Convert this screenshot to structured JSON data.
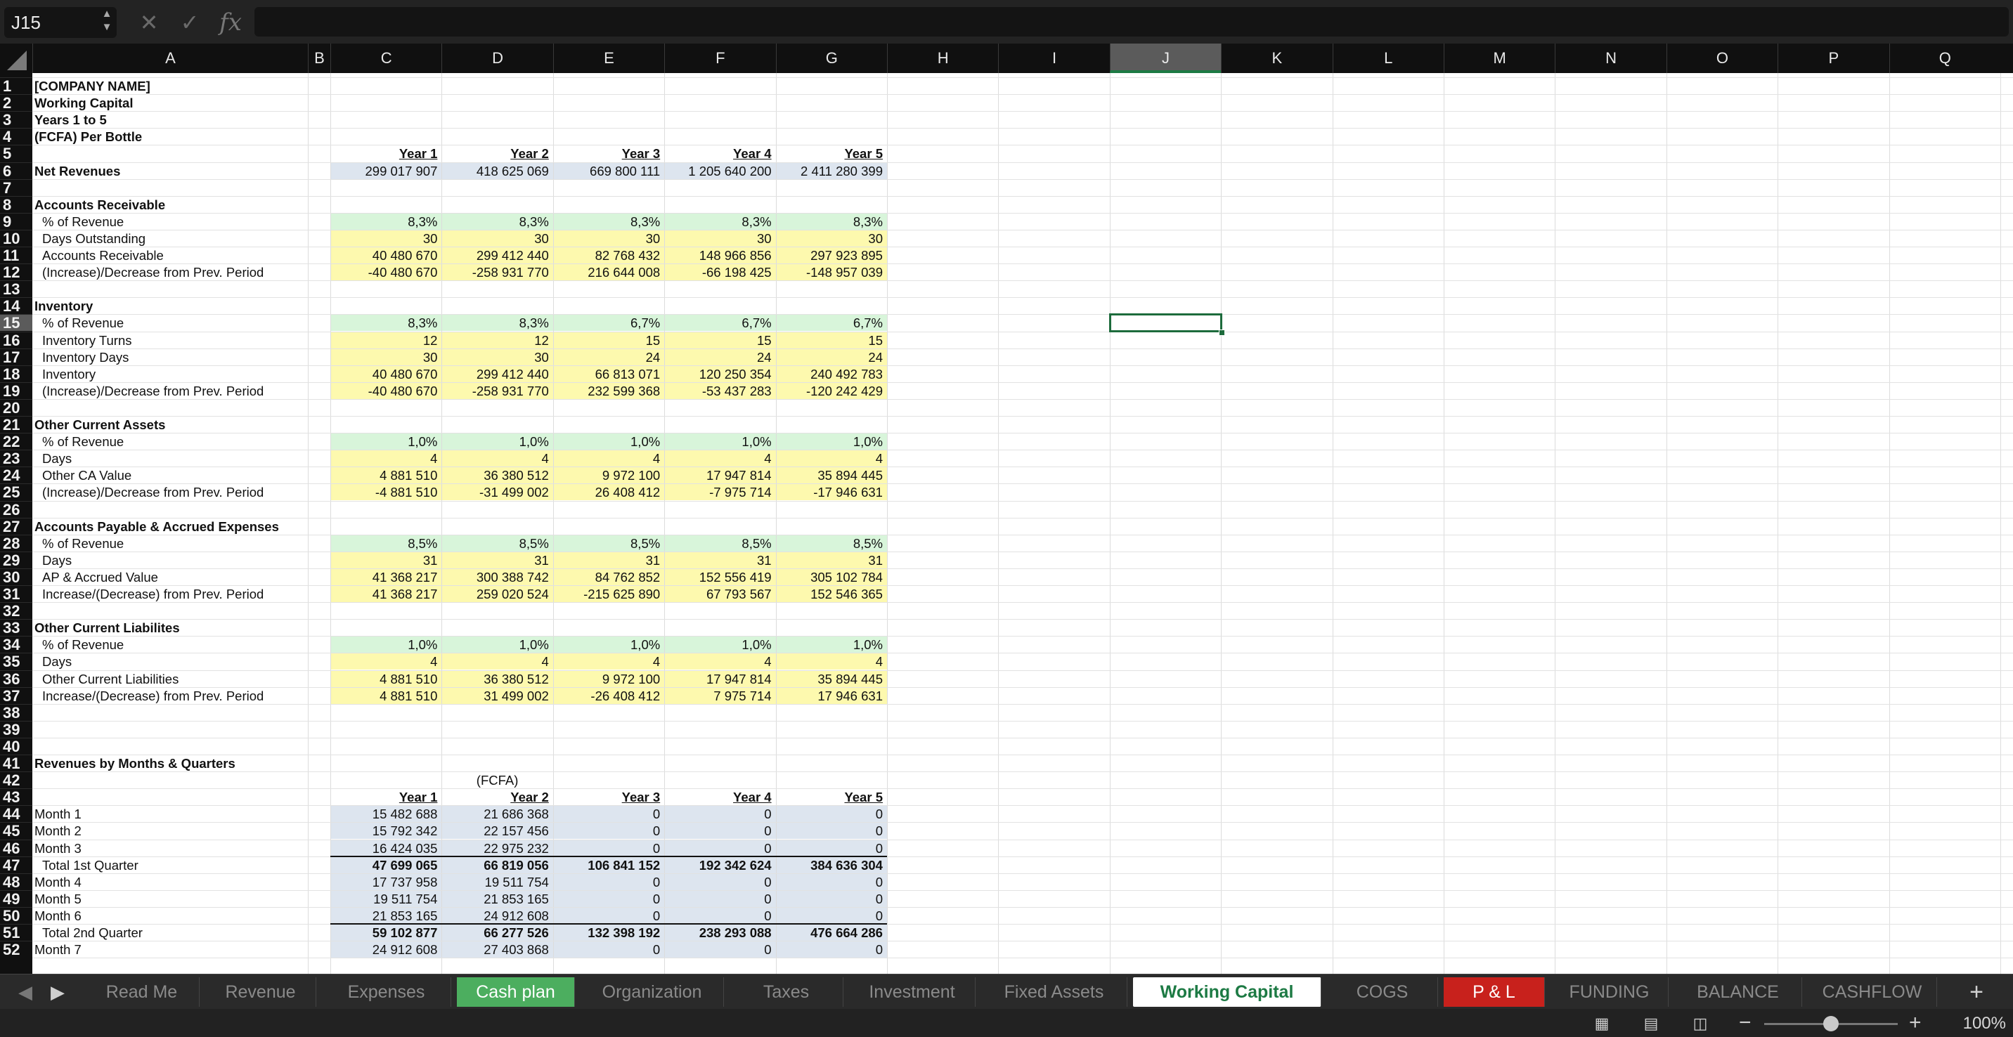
{
  "formula_bar": {
    "name_box": "J15",
    "cancel_glyph": "✕",
    "enter_glyph": "✓",
    "fx_glyph": "fx",
    "formula": ""
  },
  "columns": [
    "A",
    "B",
    "C",
    "D",
    "E",
    "F",
    "G",
    "H",
    "I",
    "J",
    "K",
    "L",
    "M",
    "N",
    "O",
    "P",
    "Q"
  ],
  "selected_column": "J",
  "selected_row": 15,
  "selected_cell": "J15",
  "rows": [
    1,
    2,
    3,
    4,
    5,
    6,
    7,
    8,
    9,
    10,
    11,
    12,
    13,
    14,
    15,
    16,
    17,
    18,
    19,
    20,
    21,
    22,
    23,
    24,
    25,
    26,
    27,
    28,
    29,
    30,
    31,
    32,
    33,
    34,
    35,
    36,
    37,
    38,
    39,
    40,
    41,
    42,
    43,
    44,
    45,
    46,
    47,
    48,
    49,
    50,
    51,
    52
  ],
  "colors": {
    "green_fill": "#d8f5da",
    "yellow_fill": "#fdf9ae",
    "blue_fill": "#dde5ef",
    "selection": "#1d6b3c",
    "tab_green": "#4cae5f",
    "tab_red": "#c8211c"
  },
  "sheet": {
    "a1": "[COMPANY NAME]",
    "a2": "Working Capital",
    "a3": "Years 1 to 5",
    "a4": "(FCFA) Per Bottle",
    "years": [
      "Year 1",
      "Year 2",
      "Year 3",
      "Year 4",
      "Year 5"
    ],
    "net_revenues": {
      "label": "Net Revenues",
      "values": [
        "299 017 907",
        "418 625 069",
        "669 800 111",
        "1 205 640 200",
        "2 411 280 399"
      ]
    },
    "sections": [
      {
        "title": "Accounts Receivable",
        "row": 8,
        "rows": [
          {
            "label": "% of Revenue",
            "values": [
              "8,3%",
              "8,3%",
              "8,3%",
              "8,3%",
              "8,3%"
            ]
          },
          {
            "label": "Days Outstanding",
            "values": [
              "30",
              "30",
              "30",
              "30",
              "30"
            ]
          },
          {
            "label": "Accounts Receivable",
            "values": [
              "40 480 670",
              "299 412 440",
              "82 768 432",
              "148 966 856",
              "297 923 895"
            ]
          },
          {
            "label": "(Increase)/Decrease from Prev. Period",
            "values": [
              "-40 480 670",
              "-258 931 770",
              "216 644 008",
              "-66 198 425",
              "-148 957 039"
            ]
          }
        ]
      },
      {
        "title": "Inventory",
        "row": 14,
        "rows": [
          {
            "label": "% of Revenue",
            "values": [
              "8,3%",
              "8,3%",
              "6,7%",
              "6,7%",
              "6,7%"
            ]
          },
          {
            "label": "Inventory Turns",
            "values": [
              "12",
              "12",
              "15",
              "15",
              "15"
            ]
          },
          {
            "label": "Inventory Days",
            "values": [
              "30",
              "30",
              "24",
              "24",
              "24"
            ]
          },
          {
            "label": "Inventory",
            "values": [
              "40 480 670",
              "299 412 440",
              "66 813 071",
              "120 250 354",
              "240 492 783"
            ]
          },
          {
            "label": "(Increase)/Decrease from Prev. Period",
            "values": [
              "-40 480 670",
              "-258 931 770",
              "232 599 368",
              "-53 437 283",
              "-120 242 429"
            ]
          }
        ]
      },
      {
        "title": "Other Current Assets",
        "row": 21,
        "rows": [
          {
            "label": "% of Revenue",
            "values": [
              "1,0%",
              "1,0%",
              "1,0%",
              "1,0%",
              "1,0%"
            ]
          },
          {
            "label": "Days",
            "values": [
              "4",
              "4",
              "4",
              "4",
              "4"
            ]
          },
          {
            "label": "Other CA Value",
            "values": [
              "4 881 510",
              "36 380 512",
              "9 972 100",
              "17 947 814",
              "35 894 445"
            ]
          },
          {
            "label": "(Increase)/Decrease from Prev. Period",
            "values": [
              "-4 881 510",
              "-31 499 002",
              "26 408 412",
              "-7 975 714",
              "-17 946 631"
            ]
          }
        ]
      },
      {
        "title": "Accounts Payable & Accrued Expenses",
        "row": 27,
        "rows": [
          {
            "label": "% of Revenue",
            "values": [
              "8,5%",
              "8,5%",
              "8,5%",
              "8,5%",
              "8,5%"
            ]
          },
          {
            "label": "Days",
            "values": [
              "31",
              "31",
              "31",
              "31",
              "31"
            ]
          },
          {
            "label": "AP & Accrued Value",
            "values": [
              "41 368 217",
              "300 388 742",
              "84 762 852",
              "152 556 419",
              "305 102 784"
            ]
          },
          {
            "label": "Increase/(Decrease) from Prev. Period",
            "values": [
              "41 368 217",
              "259 020 524",
              "-215 625 890",
              "67 793 567",
              "152 546 365"
            ]
          }
        ]
      },
      {
        "title": "Other Current Liabilites",
        "row": 33,
        "rows": [
          {
            "label": "% of Revenue",
            "values": [
              "1,0%",
              "1,0%",
              "1,0%",
              "1,0%",
              "1,0%"
            ]
          },
          {
            "label": "Days",
            "values": [
              "4",
              "4",
              "4",
              "4",
              "4"
            ]
          },
          {
            "label": "Other Current Liabilities",
            "values": [
              "4 881 510",
              "36 380 512",
              "9 972 100",
              "17 947 814",
              "35 894 445"
            ]
          },
          {
            "label": "Increase/(Decrease) from Prev. Period",
            "values": [
              "4 881 510",
              "31 499 002",
              "-26 408 412",
              "7 975 714",
              "17 946 631"
            ]
          }
        ]
      }
    ],
    "rev_months_title": "Revenues by Months & Quarters",
    "currency_label": "(FCFA)",
    "months": [
      {
        "label": "Month 1",
        "values": [
          "15 482 688",
          "21 686 368",
          "0",
          "0",
          "0"
        ]
      },
      {
        "label": "Month 2",
        "values": [
          "15 792 342",
          "22 157 456",
          "0",
          "0",
          "0"
        ]
      },
      {
        "label": "Month 3",
        "values": [
          "16 424 035",
          "22 975 232",
          "0",
          "0",
          "0"
        ]
      },
      {
        "label": "Total 1st Quarter",
        "total": true,
        "values": [
          "47 699 065",
          "66 819 056",
          "106 841 152",
          "192 342 624",
          "384 636 304"
        ]
      },
      {
        "label": "Month 4",
        "values": [
          "17 737 958",
          "19 511 754",
          "0",
          "0",
          "0"
        ]
      },
      {
        "label": "Month 5",
        "values": [
          "19 511 754",
          "21 853 165",
          "0",
          "0",
          "0"
        ]
      },
      {
        "label": "Month 6",
        "values": [
          "21 853 165",
          "24 912 608",
          "0",
          "0",
          "0"
        ]
      },
      {
        "label": "Total 2nd Quarter",
        "total": true,
        "values": [
          "59 102 877",
          "66 277 526",
          "132 398 192",
          "238 293 088",
          "476 664 286"
        ]
      },
      {
        "label": "Month 7",
        "values": [
          "24 912 608",
          "27 403 868",
          "0",
          "0",
          "0"
        ]
      }
    ]
  },
  "tabs": [
    {
      "label": "Read Me"
    },
    {
      "label": "Revenue"
    },
    {
      "label": "Expenses"
    },
    {
      "label": "Cash plan",
      "style": "green"
    },
    {
      "label": "Organization"
    },
    {
      "label": "Taxes"
    },
    {
      "label": "Investment"
    },
    {
      "label": "Fixed Assets"
    },
    {
      "label": "Working Capital",
      "style": "active"
    },
    {
      "label": "COGS"
    },
    {
      "label": "P & L",
      "style": "red"
    },
    {
      "label": "FUNDING"
    },
    {
      "label": "BALANCE"
    },
    {
      "label": "CASHFLOW"
    }
  ],
  "tab_nav": {
    "prev_glyph": "◀",
    "next_glyph": "▶",
    "add_glyph": "+"
  },
  "status": {
    "view_icons": [
      "normal-view-icon",
      "page-layout-icon",
      "page-break-icon"
    ],
    "zoom_minus": "−",
    "zoom_plus": "+",
    "zoom_level": "100%"
  }
}
